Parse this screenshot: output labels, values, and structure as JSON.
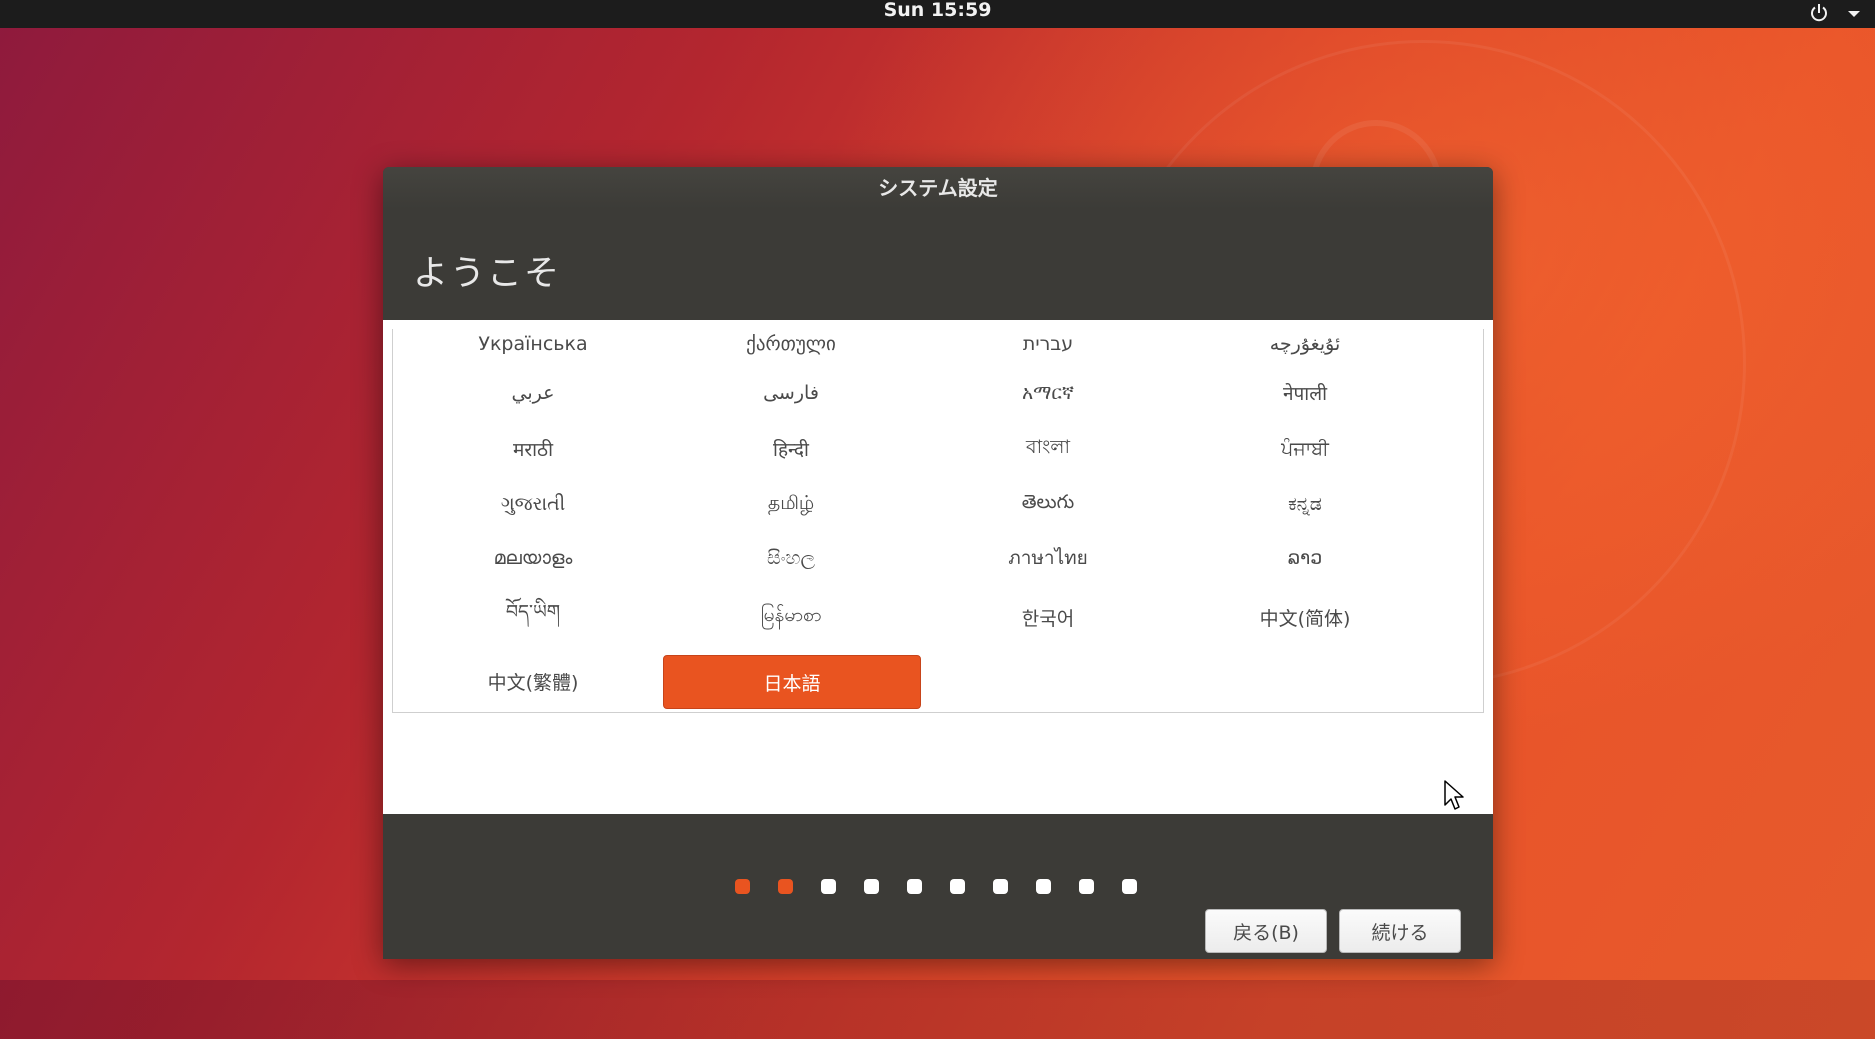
{
  "topbar": {
    "clock": "Sun 15:59",
    "power_icon": "power-icon",
    "menu_icon": "chevron-down-icon"
  },
  "dialog": {
    "title": "システム設定",
    "heading": "ようこそ",
    "languages": [
      "Українська",
      "ქართული",
      "עברית",
      "ئۇيغۇرچە",
      "عربي",
      "فارسی",
      "አማርኛ",
      "नेपाली",
      "मराठी",
      "हिन्दी",
      "বাংলা",
      "ਪੰਜਾਬੀ",
      "ગુજરાતી",
      "தமிழ்",
      "తెలుగు",
      "ಕನ್ನಡ",
      "മലയാളം",
      "සිංහල",
      "ภาษาไทย",
      "ລາວ",
      "བོད་ཡིག",
      "မြန်မာစာ",
      "한국어",
      "中文(简体)",
      "中文(繁體)",
      "日本語"
    ],
    "selected_language": "日本語",
    "back_label": "戻る(B)",
    "continue_label": "続ける",
    "progress": {
      "total_steps": 10,
      "current_step": 2
    }
  },
  "colors": {
    "accent": "#e95420",
    "dialog_bg": "#3c3b37",
    "topbar_bg": "#1c1c1c"
  }
}
